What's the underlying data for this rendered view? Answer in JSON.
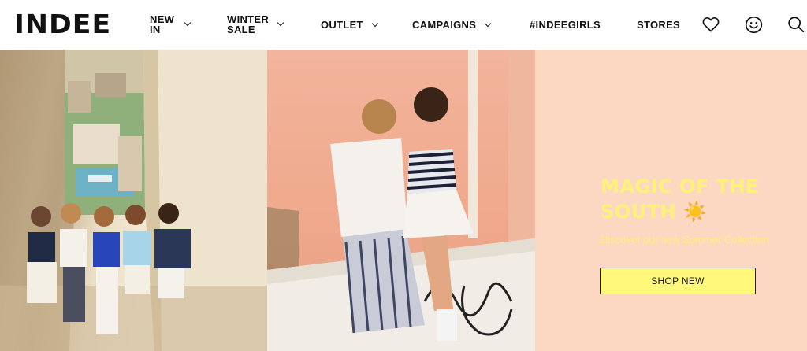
{
  "brand": {
    "logo_text": "INDEE"
  },
  "nav": {
    "new_in": {
      "line1": "NEW",
      "line2": "IN"
    },
    "winter_sale": {
      "line1": "WINTER",
      "line2": "SALE"
    },
    "outlet": "OUTLET",
    "campaigns": "CAMPAIGNS",
    "indeegirls": "#INDEEGIRLS",
    "stores": "STORES"
  },
  "header_icons": [
    "heart-icon",
    "account-smiley-icon",
    "search-icon"
  ],
  "hero": {
    "title": "MAGIC OF THE SOUTH",
    "title_emoji": "☀️",
    "subtitle": "Discover our new Summer Collection",
    "cta_label": "SHOP NEW"
  },
  "colors": {
    "accent_yellow": "#fff27a",
    "button_yellow": "#fff87a",
    "panel_peach": "#fcd7c1",
    "wall_coral": "#f0a98c"
  }
}
